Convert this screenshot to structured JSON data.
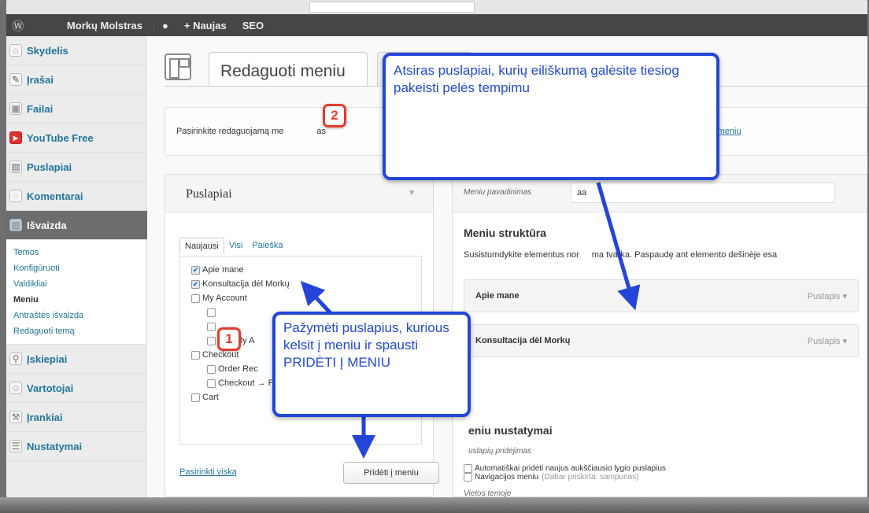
{
  "admin_bar": {
    "site_name": "Morkų Molstras",
    "new_label": "+ Naujas",
    "seo_label": "SEO"
  },
  "sidebar": {
    "items": [
      {
        "label": "Skydelis",
        "icon": "home-icon"
      },
      {
        "label": "Įrašai",
        "icon": "pin-icon"
      },
      {
        "label": "Failai",
        "icon": "media-icon"
      },
      {
        "label": "YouTube Free",
        "icon": "youtube-icon"
      },
      {
        "label": "Puslapiai",
        "icon": "page-icon"
      },
      {
        "label": "Komentarai",
        "icon": "comment-icon"
      },
      {
        "label": "Išvaizda",
        "icon": "appearance-icon"
      }
    ],
    "submenu": [
      "Temos",
      "Konfigūruoti",
      "Valdikliai",
      "Meniu",
      "Antraštės išvaizda",
      "Redaguoti temą"
    ],
    "items_after": [
      {
        "label": "Įskiepiai",
        "icon": "plugin-icon"
      },
      {
        "label": "Vartotojai",
        "icon": "users-icon"
      },
      {
        "label": "Įrankiai",
        "icon": "tools-icon"
      },
      {
        "label": "Nustatymai",
        "icon": "settings-icon"
      }
    ]
  },
  "header": {
    "tab_title": "Redaguoti meniu"
  },
  "select_bar": {
    "label": "Pasirinkite redaguojamą me",
    "label_tail": "as",
    "create_link": "ia meniu"
  },
  "pages_box": {
    "title": "Puslapiai",
    "tabs": [
      "Naujausi",
      "Visi",
      "Paieška"
    ],
    "pages": [
      {
        "label": "Apie mane",
        "checked": true,
        "level": 0
      },
      {
        "label": "Konsultacija dėl Morkų",
        "checked": true,
        "level": 0
      },
      {
        "label": "My Account",
        "checked": false,
        "level": 0
      },
      {
        "label": "",
        "checked": false,
        "level": 1
      },
      {
        "label": "",
        "checked": false,
        "level": 1
      },
      {
        "label": "Edit My A",
        "checked": false,
        "level": 1
      },
      {
        "label": "Checkout",
        "checked": false,
        "level": 0
      },
      {
        "label": "Order Rec",
        "checked": false,
        "level": 1
      },
      {
        "label": "Checkout → Pay",
        "checked": false,
        "level": 1
      },
      {
        "label": "Cart",
        "checked": false,
        "level": 0
      }
    ],
    "select_all": "Pasirinkti viską",
    "add_button": "Pridėti į meniu"
  },
  "menu_box": {
    "name_label": "Meniu pavadinimas",
    "name_value": "aa",
    "structure_title": "Meniu struktūra",
    "structure_desc": "Susistumdykite elementus nor",
    "structure_desc_tail": "ma tvarka. Paspaudę ant elemento dešinėje esa",
    "items": [
      {
        "title": "Apie mane",
        "kind": "Puslapis"
      },
      {
        "title": "Konsultacija dėl Morkų",
        "kind": "Puslapis"
      }
    ],
    "settings_title": "eniu nustatymai",
    "auto_add_label": "uslapių pridėjimas",
    "auto_add_option": "Automatiškai pridėti naujus aukščiausio lygio puslapius",
    "location_label": "Vietos temoje",
    "location_option": "Navigacijos meniu",
    "location_hint": "(Dabar priskirta: sampunas)"
  },
  "annotations": {
    "callout_top": "Atsiras puslapiai, kurių eiliškumą galėsite tiesiog pakeisti pelės tempimu",
    "callout_bottom": "Pažymėti puslapius, kurious kelsit į meniu ir spausti PRIDĖTI Į MENIU",
    "badge_1": "1",
    "badge_2": "2",
    "accent": "#2346d8",
    "badge_color": "#e43c2c"
  }
}
